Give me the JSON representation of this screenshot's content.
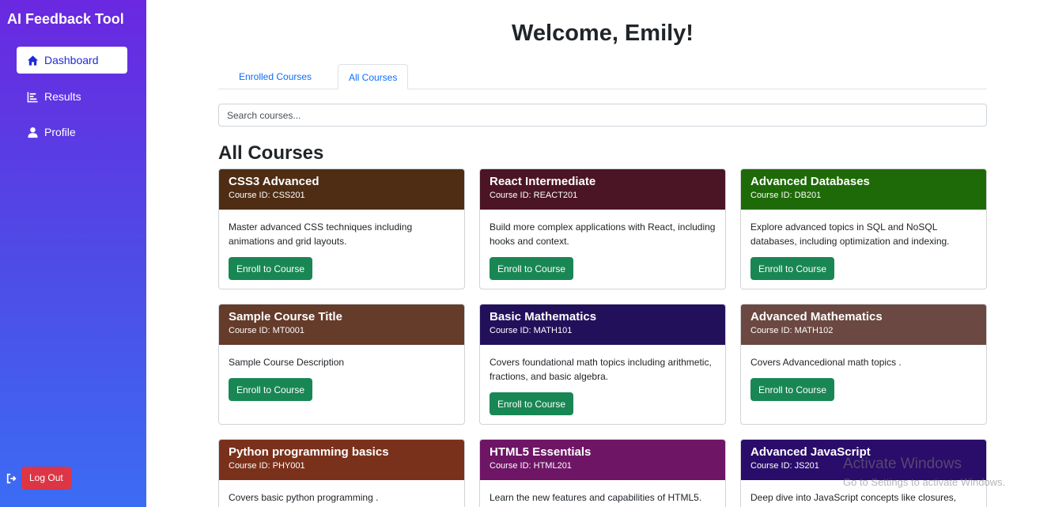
{
  "app": {
    "title": "AI Feedback Tool"
  },
  "sidebar": {
    "items": [
      {
        "label": "Dashboard",
        "icon": "home-icon",
        "active": true
      },
      {
        "label": "Results",
        "icon": "bar-chart-icon",
        "active": false
      },
      {
        "label": "Profile",
        "icon": "user-icon",
        "active": false
      }
    ],
    "logout_label": "Log Out"
  },
  "main": {
    "welcome": "Welcome, Emily!",
    "tabs": [
      {
        "label": "Enrolled Courses",
        "active": false
      },
      {
        "label": "All Courses",
        "active": true
      }
    ],
    "search_placeholder": "Search courses...",
    "section_title": "All Courses",
    "enroll_label": "Enroll to Course",
    "courses": [
      {
        "title": "CSS3 Advanced",
        "id": "Course ID: CSS201",
        "desc": "Master advanced CSS techniques including animations and grid layouts.",
        "color": "#4e2d14"
      },
      {
        "title": "React Intermediate",
        "id": "Course ID: REACT201",
        "desc": "Build more complex applications with React, including hooks and context.",
        "color": "#4b1525"
      },
      {
        "title": "Advanced Databases",
        "id": "Course ID: DB201",
        "desc": "Explore advanced topics in SQL and NoSQL databases, including optimization and indexing.",
        "color": "#1e6a08"
      },
      {
        "title": "Sample Course Title",
        "id": "Course ID: MT0001",
        "desc": "Sample Course Description",
        "color": "#653b2a"
      },
      {
        "title": "Basic Mathematics",
        "id": "Course ID: MATH101",
        "desc": "Covers foundational math topics including arithmetic, fractions, and basic algebra.",
        "color": "#23105b"
      },
      {
        "title": "Advanced Mathematics",
        "id": "Course ID: MATH102",
        "desc": "Covers Advancedional math topics .",
        "color": "#6b4841"
      },
      {
        "title": "Python programming basics",
        "id": "Course ID: PHY001",
        "desc": "Covers basic python programming .",
        "color": "#7a311b"
      },
      {
        "title": "HTML5 Essentials",
        "id": "Course ID: HTML201",
        "desc": "Learn the new features and capabilities of HTML5.",
        "color": "#6e1565"
      },
      {
        "title": "Advanced JavaScript",
        "id": "Course ID: JS201",
        "desc": "Deep dive into JavaScript concepts like closures,",
        "color": "#2a0c6a"
      }
    ]
  },
  "watermark": {
    "title": "Activate Windows",
    "subtitle": "Go to Settings to activate Windows."
  }
}
